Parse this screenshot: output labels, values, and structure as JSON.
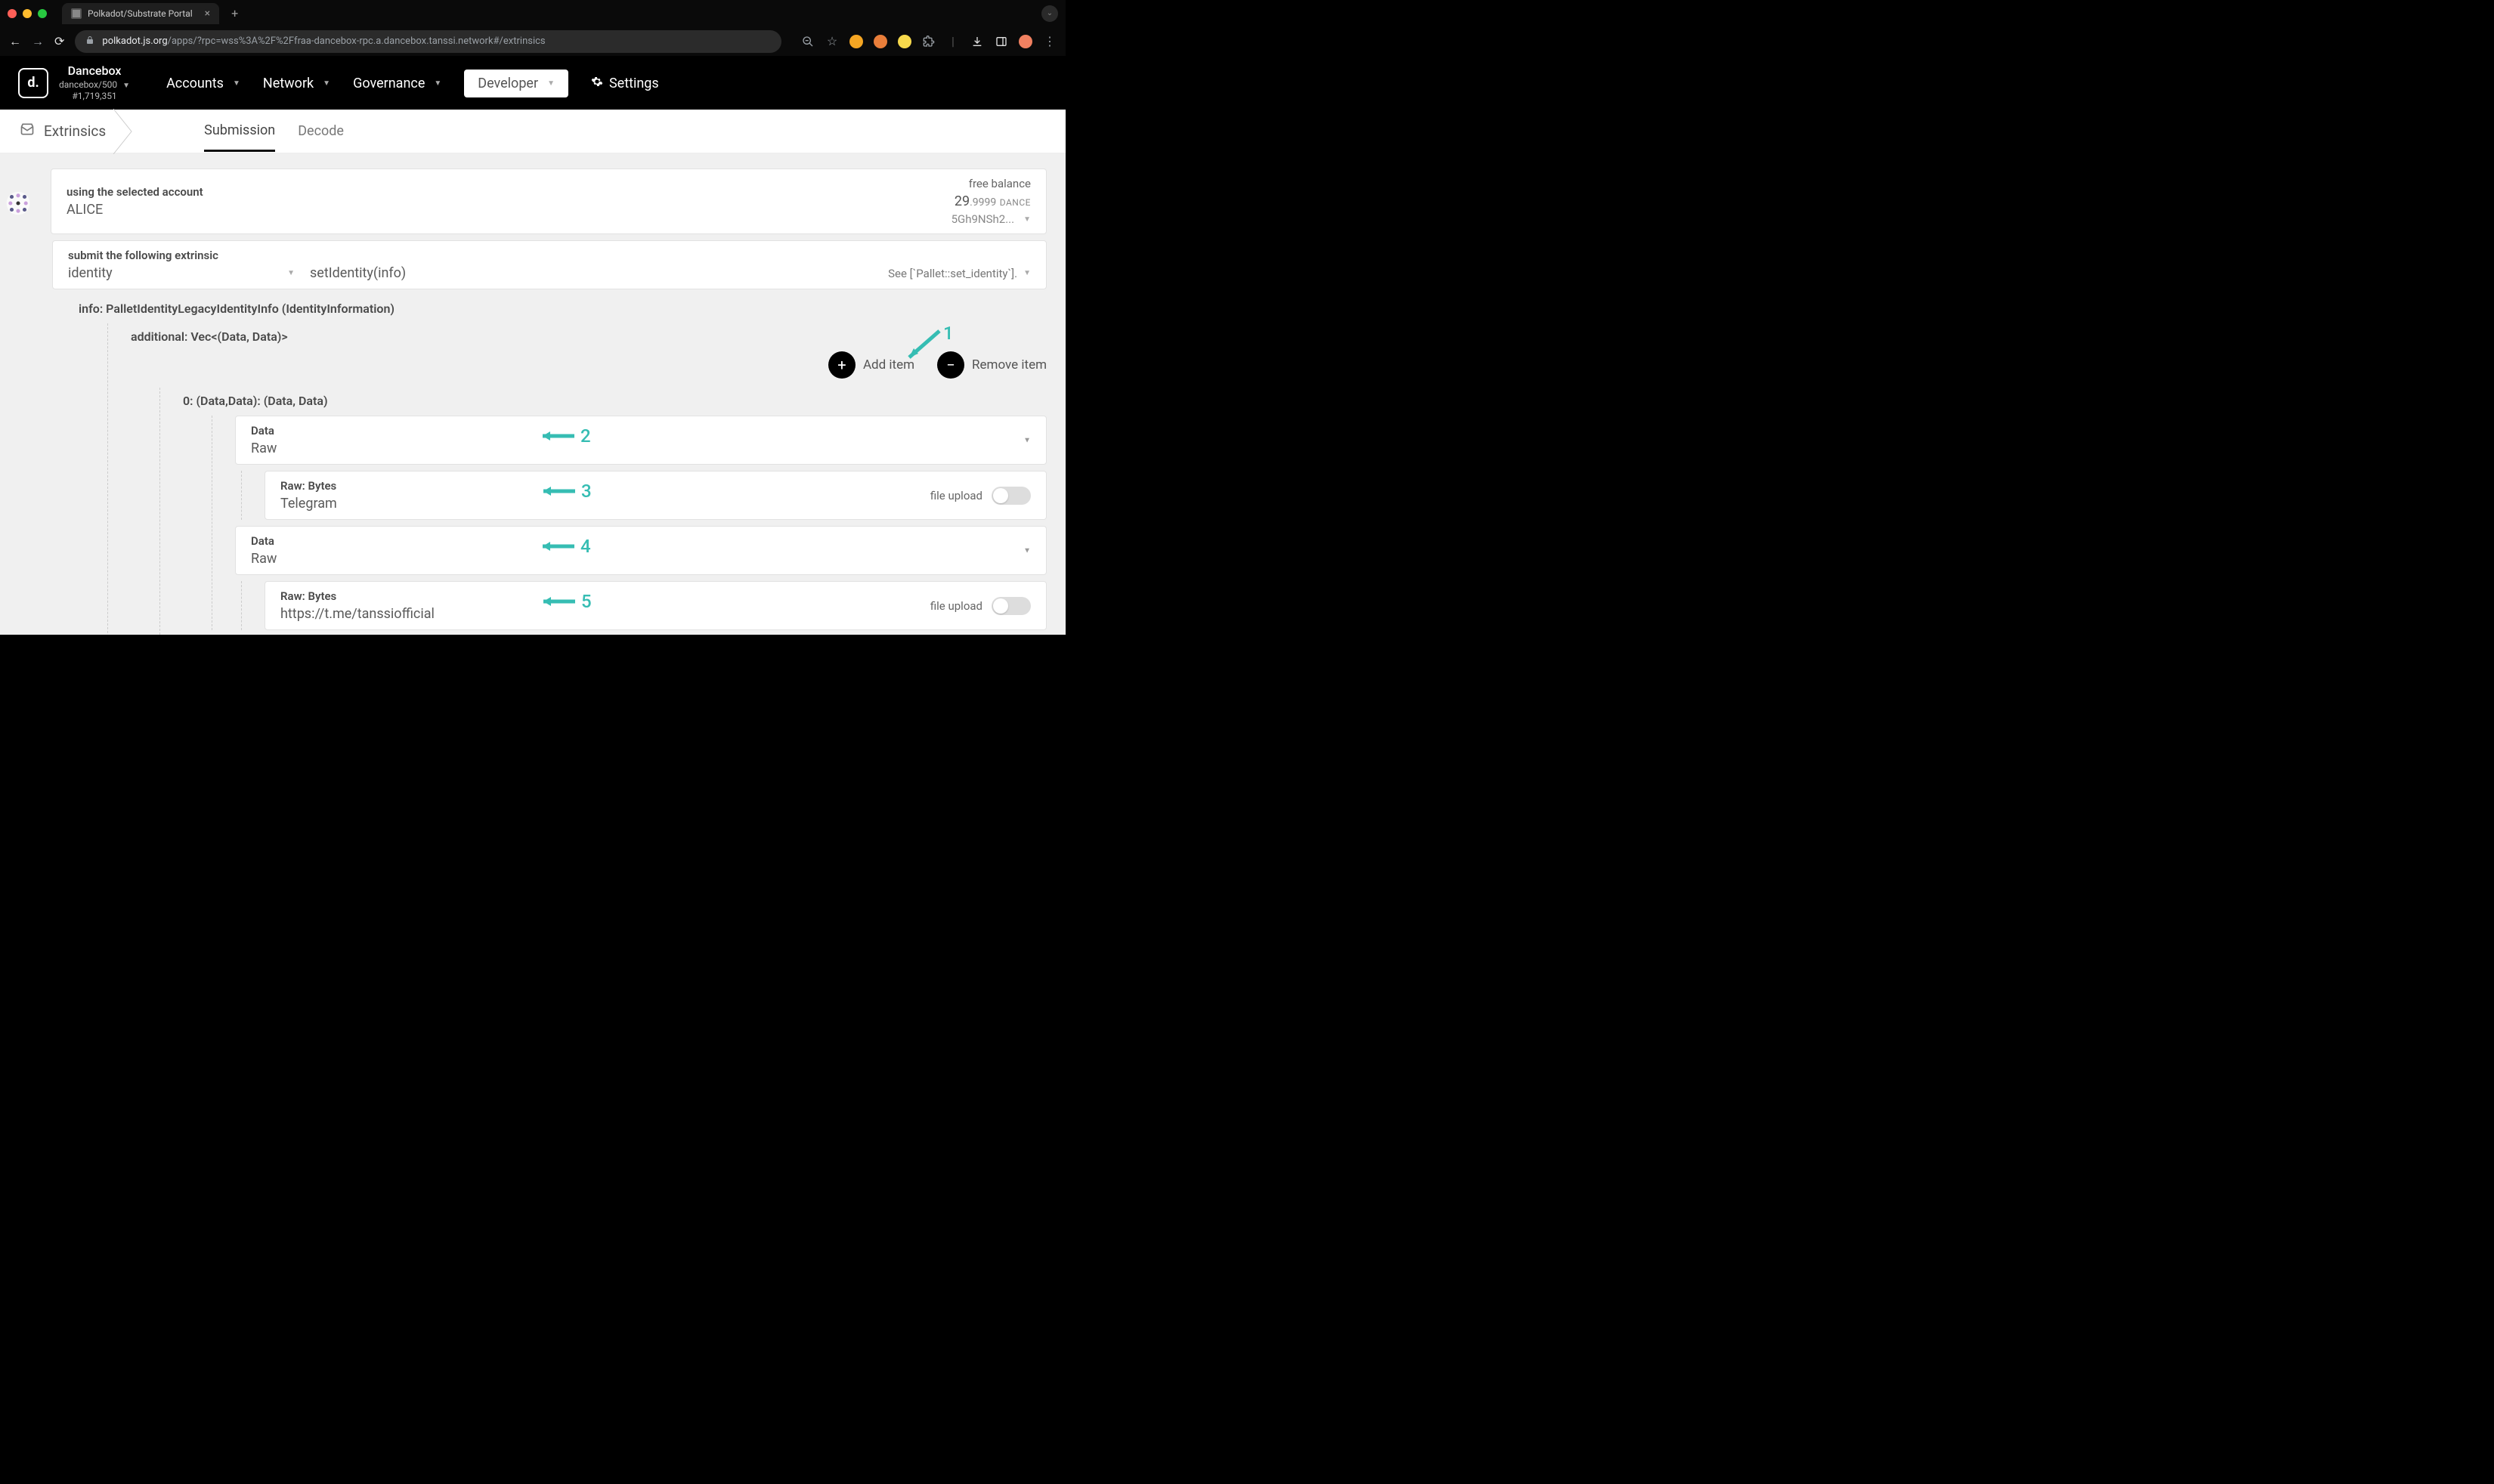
{
  "browser": {
    "tab_title": "Polkadot/Substrate Portal",
    "url_host": "polkadot.js.org",
    "url_path": "/apps/?rpc=wss%3A%2F%2Ffraa-dancebox-rpc.a.dancebox.tanssi.network#/extrinsics"
  },
  "appbar": {
    "chain_name": "Dancebox",
    "chain_sub": "dancebox/500",
    "block": "#1,719,351",
    "nav": {
      "accounts": "Accounts",
      "network": "Network",
      "governance": "Governance",
      "developer": "Developer",
      "settings": "Settings"
    }
  },
  "subnav": {
    "main": "Extrinsics",
    "tab_submission": "Submission",
    "tab_decode": "Decode"
  },
  "account": {
    "label": "using the selected account",
    "name": "ALICE",
    "balance_label": "free balance",
    "balance_int": "29",
    "balance_dec": ".9999",
    "balance_unit": "DANCE",
    "short_addr": "5Gh9NSh2..."
  },
  "extrinsic": {
    "label": "submit the following extrinsic",
    "pallet": "identity",
    "call": "setIdentity(info)",
    "docs_link": "See [`Pallet::set_identity`]."
  },
  "params": {
    "info_label": "info: PalletIdentityLegacyIdentityInfo (IdentityInformation)",
    "additional_label": "additional: Vec<(Data, Data)>",
    "add_item": "Add item",
    "remove_item": "Remove item",
    "item0_label": "0: (Data,Data): (Data, Data)",
    "fields": [
      {
        "label": "Data",
        "value": "Raw",
        "type": "select"
      },
      {
        "label": "Raw: Bytes",
        "value": "Telegram",
        "type": "bytes",
        "file_upload": "file upload"
      },
      {
        "label": "Data",
        "value": "Raw",
        "type": "select"
      },
      {
        "label": "Raw: Bytes",
        "value": "https://t.me/tanssiofficial",
        "type": "bytes",
        "file_upload": "file upload"
      }
    ]
  },
  "annotations": [
    "1",
    "2",
    "3",
    "4",
    "5"
  ]
}
